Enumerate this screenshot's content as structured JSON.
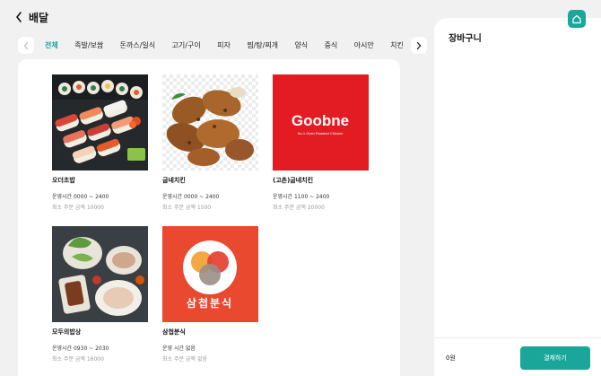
{
  "header": {
    "title": "배달",
    "back_icon": "chevron-left-icon"
  },
  "categories": {
    "prev_icon": "chevron-left-icon",
    "next_icon": "chevron-right-icon",
    "items": [
      "전체",
      "족발/보쌈",
      "돈까스/일식",
      "고기/구이",
      "피자",
      "찜/탕/찌개",
      "양식",
      "중식",
      "아시안",
      "치킨"
    ],
    "active_index": 0
  },
  "restaurants": [
    {
      "name": "오더초밥",
      "hours": "운영시간 0000 ~ 2400",
      "min_order": "최소 주문 금액 10000",
      "image": "sushi-platter"
    },
    {
      "name": "굽네치킨",
      "hours": "운영시간 0000 ~ 2400",
      "min_order": "최소 주문 금액 1500",
      "image": "roasted-chicken"
    },
    {
      "name": "(고촌)굽네치킨",
      "hours": "운영시간 1100 ~ 2400",
      "min_order": "최소 주문 금액 20000",
      "image": "goobne-logo",
      "logo_text": "Goobne",
      "logo_tagline": "No.1 Oven Roasted Chicken"
    },
    {
      "name": "모두의밥상",
      "hours": "운영시간 0930 ~ 2030",
      "min_order": "최소 주문 금액 16000",
      "image": "korean-meal-table"
    },
    {
      "name": "삼첩분식",
      "hours": "운영 시간 없음",
      "min_order": "최소 주문 금액 없음",
      "image": "samchup-logo",
      "logo_text": "삼첩분식"
    }
  ],
  "cart": {
    "title": "장바구니",
    "total": "0원",
    "checkout_label": "결제하기"
  },
  "home_icon": "home-icon",
  "colors": {
    "accent": "#1aa79a",
    "goobne_red": "#e31b23",
    "samchup_red": "#e8492f",
    "background": "#f1f1f1"
  }
}
